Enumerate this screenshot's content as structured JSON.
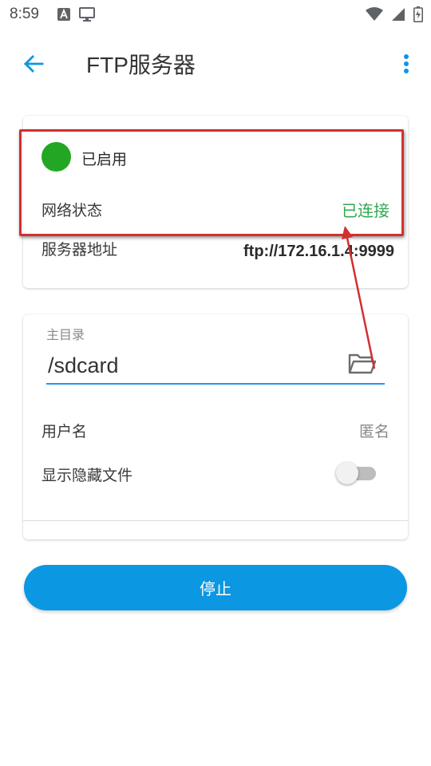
{
  "status_bar": {
    "time": "8:59"
  },
  "app_bar": {
    "title": "FTP服务器",
    "back_icon": "arrow-left-icon",
    "more_icon": "more-vert-icon"
  },
  "status_card": {
    "enabled_text": "已启用",
    "network_label": "网络状态",
    "network_value": "已连接",
    "address_label": "服务器地址",
    "address_value": "ftp://172.16.1.4:9999"
  },
  "settings_card": {
    "home_dir_label": "主目录",
    "home_dir_value": "/sdcard",
    "username_label": "用户名",
    "username_value": "匿名",
    "show_hidden_label": "显示隐藏文件",
    "show_hidden_on": false
  },
  "stop_button_label": "停止",
  "colors": {
    "accent": "#0c97e3",
    "enabled": "#23a623",
    "connected": "#2fa84f",
    "annotation": "#d32f2f"
  }
}
